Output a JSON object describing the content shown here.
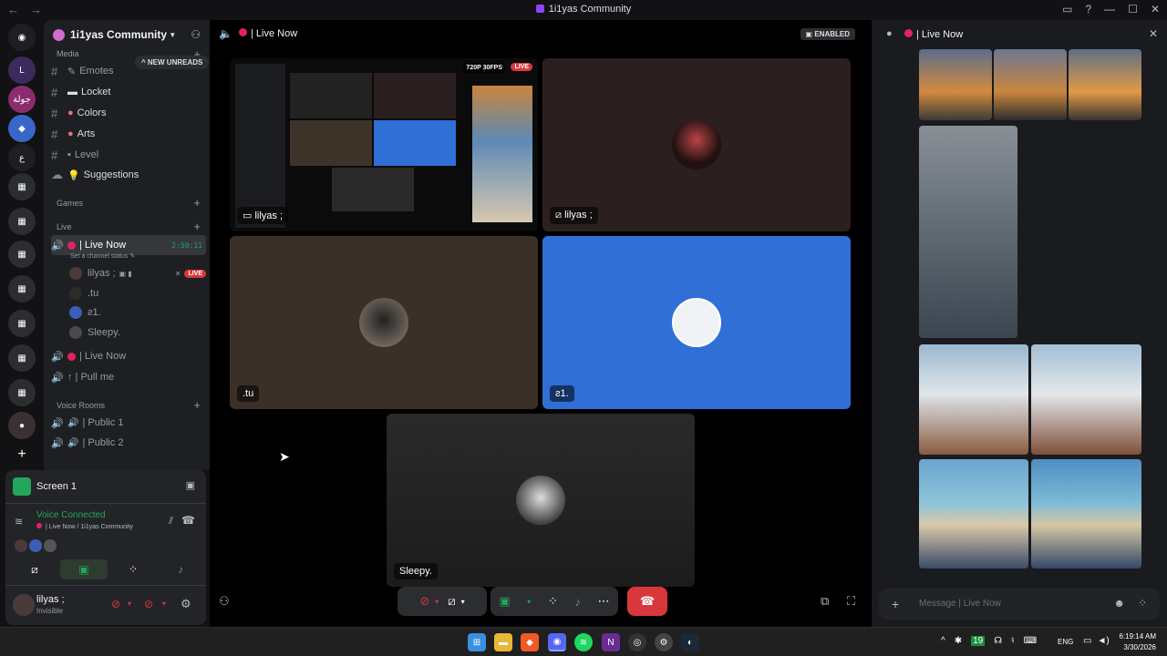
{
  "window": {
    "title": "1i1yas Community"
  },
  "guild": {
    "name": "1i1yas Community",
    "new_unreads": "NEW UNREADS"
  },
  "channels": {
    "media_cat": "Media",
    "text": [
      {
        "label": "Emotes",
        "icon": "✎"
      },
      {
        "label": "Locket",
        "icon": "▬"
      },
      {
        "label": "Colors",
        "icon": "●"
      },
      {
        "label": "Arts",
        "icon": "●"
      },
      {
        "label": "Level",
        "icon": "▪"
      },
      {
        "label": "Suggestions",
        "icon": "💡"
      }
    ],
    "games_cat": "Games",
    "live_cat": "Live",
    "live_now": "| Live Now",
    "live_timer": "2:50:11",
    "channel_status": "Set a channel status",
    "voice_users": [
      {
        "name": "lilyas ;",
        "live": "LIVE"
      },
      {
        "name": ".tu"
      },
      {
        "name": "ƨ1."
      },
      {
        "name": "Sleepy."
      }
    ],
    "live_now_2": "| Live Now",
    "pull_me": "↑ | Pull me",
    "voice_rooms_cat": "Voice Rooms",
    "public1": "| Public 1",
    "public2": "| Public 2"
  },
  "screen_share": {
    "title": "Screen 1"
  },
  "voice": {
    "status": "Voice Connected",
    "location": "| Live Now / 1i1yas Community"
  },
  "user": {
    "name": "lilyas ;",
    "status": "Invisible"
  },
  "stage": {
    "channel": "| Live Now",
    "enabled_badge": "ENABLED",
    "tiles": [
      {
        "label": "lilyas ;",
        "quality": "720P 30FPS",
        "live": "LIVE"
      },
      {
        "label": "lilyas ;"
      },
      {
        "label": ".tu"
      },
      {
        "label": "ƨ1."
      },
      {
        "label": "Sleepy."
      }
    ]
  },
  "chat": {
    "channel": "| Live Now",
    "placeholder": "Message | Live Now"
  },
  "tray": {
    "lang": "ENG",
    "time": "6:19:14 AM",
    "date": "3/30/2026"
  },
  "colors": {
    "accent": "#5865f2",
    "live": "#da373c",
    "connected": "#23a55a",
    "blue_tile": "#2f6fd6"
  }
}
